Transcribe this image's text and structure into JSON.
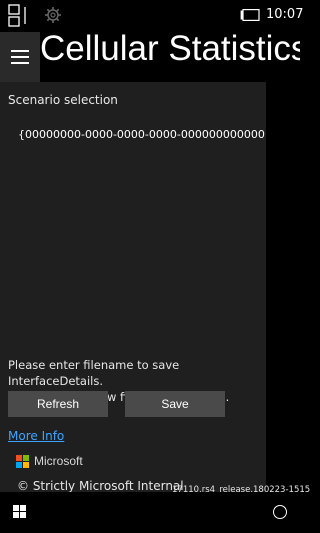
{
  "status_bar": {
    "time": "10:07",
    "icons": [
      "app-switch-icon",
      "gear-icon",
      "battery-icon"
    ]
  },
  "header": {
    "title": "Cellular Statistics",
    "menu_icon": "hamburger-icon"
  },
  "scenario": {
    "label": "Scenario selection",
    "value": "{00000000-0000-0000-0000-000000000000"
  },
  "save_prompt": {
    "line1": "Please enter filename to save InterfaceDetails.",
    "line2": "If not present, new file will be created."
  },
  "buttons": {
    "refresh": "Refresh",
    "save": "Save"
  },
  "links": {
    "more_info": "More Info"
  },
  "branding": {
    "logo_text": "Microsoft",
    "copyright": "© Strictly Microsoft Internal",
    "build": "17110.rs4_release.180223-1515"
  },
  "colors": {
    "accent_link": "#3ea5ff",
    "panel_bg": "#1f1f1f",
    "button_bg": "#4a4a4a"
  },
  "nav_bar": {
    "icons": [
      "windows-icon",
      "search-icon"
    ]
  }
}
